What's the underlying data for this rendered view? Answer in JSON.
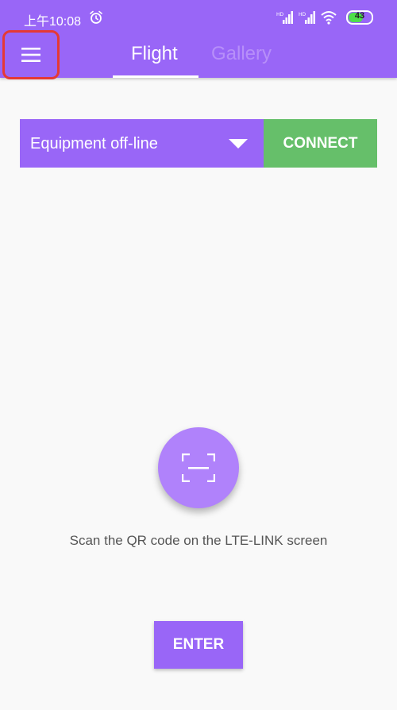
{
  "status_bar": {
    "time": "上午10:08",
    "battery_level": "43",
    "icons": [
      "alarm-icon",
      "signal-hd-icon",
      "signal-hd-icon",
      "wifi-icon",
      "battery-icon"
    ]
  },
  "header": {
    "menu_icon": "hamburger-menu-icon",
    "tabs": [
      {
        "label": "Flight",
        "active": true
      },
      {
        "label": "Gallery",
        "active": false
      }
    ]
  },
  "connection": {
    "device_status": "Equipment off-line",
    "connect_label": "CONNECT"
  },
  "scan": {
    "icon": "scan-qr-icon",
    "hint": "Scan the QR code on the LTE-LINK screen"
  },
  "enter_label": "ENTER",
  "colors": {
    "primary": "#9966f7",
    "connect": "#66bf6a",
    "scan_button": "#b082fb",
    "background": "#f9f9f9",
    "menu_highlight": "#e53935"
  }
}
